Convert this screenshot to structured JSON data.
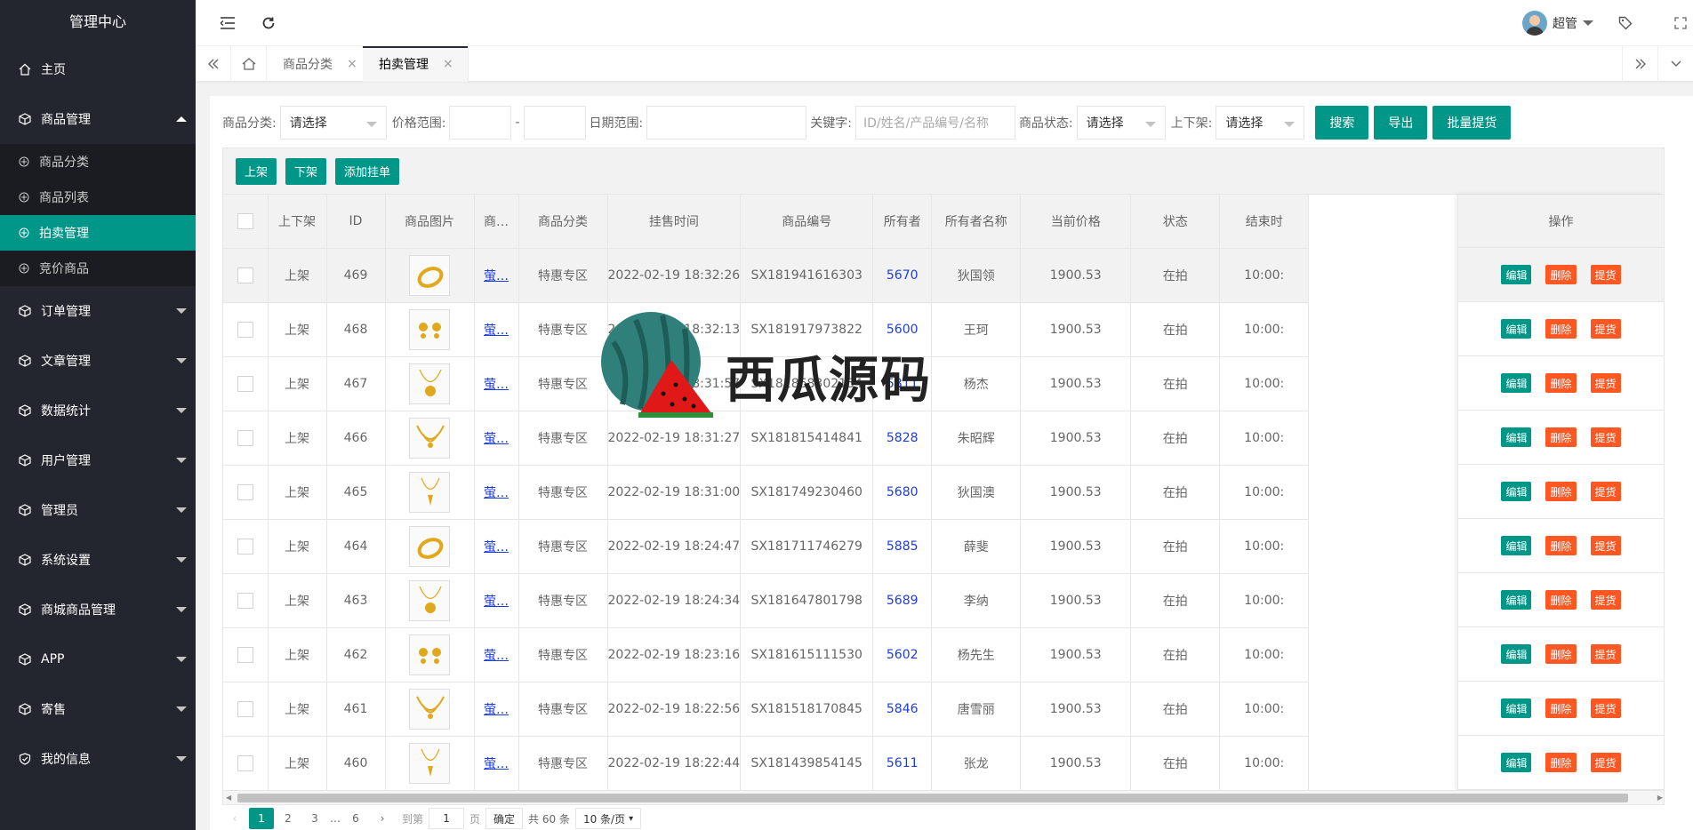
{
  "sidebar": {
    "title": "管理中心",
    "items": [
      {
        "label": "主页",
        "icon": "home-icon"
      },
      {
        "label": "商品管理",
        "icon": "cube-icon",
        "expanded": true,
        "children": [
          {
            "label": "商品分类"
          },
          {
            "label": "商品列表"
          },
          {
            "label": "拍卖管理",
            "active": true
          },
          {
            "label": "竞价商品"
          }
        ]
      },
      {
        "label": "订单管理",
        "icon": "cube-icon"
      },
      {
        "label": "文章管理",
        "icon": "cube-icon"
      },
      {
        "label": "数据统计",
        "icon": "cube-icon"
      },
      {
        "label": "用户管理",
        "icon": "cube-icon"
      },
      {
        "label": "管理员",
        "icon": "cube-icon"
      },
      {
        "label": "系统设置",
        "icon": "cube-icon"
      },
      {
        "label": "商城商品管理",
        "icon": "cube-icon"
      },
      {
        "label": "APP",
        "icon": "cube-icon"
      },
      {
        "label": "寄售",
        "icon": "cube-icon"
      },
      {
        "label": "我的信息",
        "icon": "shield-icon"
      }
    ]
  },
  "header": {
    "username": "超管"
  },
  "tabs": [
    {
      "label": "商品分类"
    },
    {
      "label": "拍卖管理",
      "active": true
    }
  ],
  "filters": {
    "category_label": "商品分类:",
    "category_value": "请选择",
    "price_label": "价格范围:",
    "price_sep": "-",
    "date_label": "日期范围:",
    "keyword_label": "关键字:",
    "keyword_placeholder": "ID/姓名/产品编号/名称",
    "status_label": "商品状态:",
    "status_value": "请选择",
    "shelf_label": "上下架:",
    "shelf_value": "请选择",
    "search_btn": "搜索",
    "export_btn": "导出",
    "batch_btn": "批量提货"
  },
  "toolbar": {
    "on_btn": "上架",
    "off_btn": "下架",
    "add_btn": "添加挂单"
  },
  "table": {
    "headers": [
      "上下架",
      "ID",
      "商品图片",
      "商…",
      "商品分类",
      "挂售时间",
      "商品编号",
      "所有者",
      "所有者名称",
      "当前价格",
      "状态",
      "结束时"
    ],
    "ops_header": "操作",
    "rows": [
      {
        "shelf": "上架",
        "id": "469",
        "img": "ring",
        "name": "萤…",
        "cat": "特惠专区",
        "time": "2022-02-19 18:32:26",
        "code": "SX181941616303",
        "owner": "5670",
        "owner_name": "狄国领",
        "price": "1900.53",
        "status": "在拍",
        "end": "10:00:"
      },
      {
        "shelf": "上架",
        "id": "468",
        "img": "earrings",
        "name": "萤…",
        "cat": "特惠专区",
        "time": "2022-02-19 18:32:13",
        "code": "SX181917973822",
        "owner": "5600",
        "owner_name": "王珂",
        "price": "1900.53",
        "status": "在拍",
        "end": "10:00:"
      },
      {
        "shelf": "上架",
        "id": "467",
        "img": "pendant",
        "name": "萤…",
        "cat": "特惠专区",
        "time": "2022-02-19 18:31:57",
        "code": "SX181868302154",
        "owner": "5811",
        "owner_name": "杨杰",
        "price": "1900.53",
        "status": "在拍",
        "end": "10:00:"
      },
      {
        "shelf": "上架",
        "id": "466",
        "img": "necklace",
        "name": "萤…",
        "cat": "特惠专区",
        "time": "2022-02-19 18:31:27",
        "code": "SX181815414841",
        "owner": "5828",
        "owner_name": "朱昭辉",
        "price": "1900.53",
        "status": "在拍",
        "end": "10:00:"
      },
      {
        "shelf": "上架",
        "id": "465",
        "img": "chain",
        "name": "萤…",
        "cat": "特惠专区",
        "time": "2022-02-19 18:31:00",
        "code": "SX181749230460",
        "owner": "5680",
        "owner_name": "狄国澳",
        "price": "1900.53",
        "status": "在拍",
        "end": "10:00:"
      },
      {
        "shelf": "上架",
        "id": "464",
        "img": "ring",
        "name": "萤…",
        "cat": "特惠专区",
        "time": "2022-02-19 18:24:47",
        "code": "SX181711746279",
        "owner": "5885",
        "owner_name": "薛斐",
        "price": "1900.53",
        "status": "在拍",
        "end": "10:00:"
      },
      {
        "shelf": "上架",
        "id": "463",
        "img": "pendant",
        "name": "萤…",
        "cat": "特惠专区",
        "time": "2022-02-19 18:24:34",
        "code": "SX181647801798",
        "owner": "5689",
        "owner_name": "李纳",
        "price": "1900.53",
        "status": "在拍",
        "end": "10:00:"
      },
      {
        "shelf": "上架",
        "id": "462",
        "img": "earrings",
        "name": "萤…",
        "cat": "特惠专区",
        "time": "2022-02-19 18:23:16",
        "code": "SX181615111530",
        "owner": "5602",
        "owner_name": "杨先生",
        "price": "1900.53",
        "status": "在拍",
        "end": "10:00:"
      },
      {
        "shelf": "上架",
        "id": "461",
        "img": "necklace",
        "name": "萤…",
        "cat": "特惠专区",
        "time": "2022-02-19 18:22:56",
        "code": "SX181518170845",
        "owner": "5846",
        "owner_name": "唐雪丽",
        "price": "1900.53",
        "status": "在拍",
        "end": "10:00:"
      },
      {
        "shelf": "上架",
        "id": "460",
        "img": "chain",
        "name": "萤…",
        "cat": "特惠专区",
        "time": "2022-02-19 18:22:44",
        "code": "SX181439854145",
        "owner": "5611",
        "owner_name": "张龙",
        "price": "1900.53",
        "status": "在拍",
        "end": "10:00:"
      }
    ],
    "op_edit": "编辑",
    "op_delete": "删除",
    "op_pick": "提货"
  },
  "pager": {
    "pages": [
      "1",
      "2",
      "3",
      "…",
      "6"
    ],
    "goto_label": "到第",
    "goto_value": "1",
    "page_unit": "页",
    "confirm": "确定",
    "total": "共 60 条",
    "per_page": "10 条/页"
  },
  "watermark": {
    "text": "西瓜源码"
  },
  "colors": {
    "accent": "#009688",
    "danger": "#ff5722",
    "sidebar_bg": "#23262e",
    "link": "#1e3cdc"
  }
}
